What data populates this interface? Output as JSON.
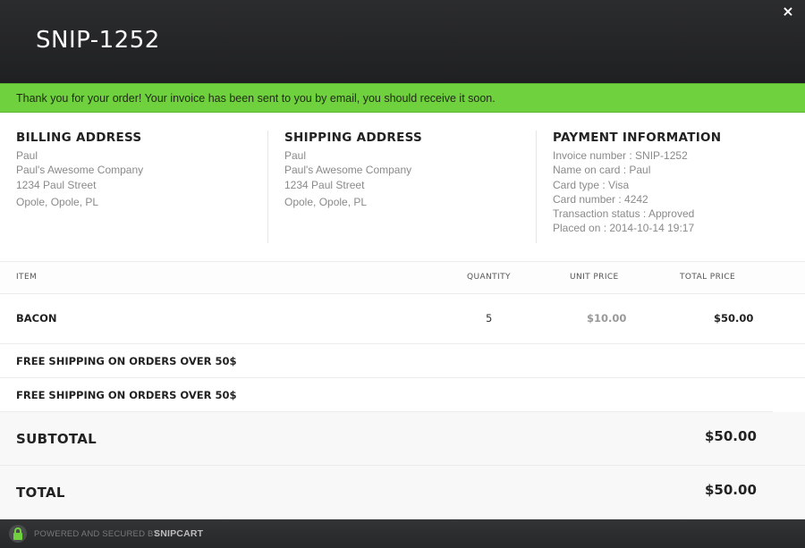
{
  "header": {
    "title": "SNIP-1252",
    "close_label": "×"
  },
  "notice": {
    "text": "Thank you for your order! Your invoice has been sent to you by email, you should receive it soon."
  },
  "billing": {
    "heading": "BILLING ADDRESS",
    "name": "Paul",
    "company": "Paul's Awesome Company",
    "street": "1234 Paul Street",
    "city": "Opole, Opole, PL"
  },
  "shipping": {
    "heading": "SHIPPING ADDRESS",
    "name": "Paul",
    "company": "Paul's Awesome Company",
    "street": "1234 Paul Street",
    "city": "Opole, Opole, PL"
  },
  "payment": {
    "heading": "PAYMENT INFORMATION",
    "invoice": "Invoice number : SNIP-1252",
    "name_on_card": "Name on card : Paul",
    "card_type": "Card type : Visa",
    "card_number": "Card number : 4242",
    "status": "Transaction status : Approved",
    "placed_on": "Placed on : 2014-10-14 19:17"
  },
  "table": {
    "headers": {
      "item": "ITEM",
      "quantity": "QUANTITY",
      "unit_price": "UNIT PRICE",
      "total_price": "TOTAL PRICE"
    },
    "items": [
      {
        "name": "BACON",
        "quantity": "5",
        "unit_price": "$10.00",
        "total_price": "$50.00"
      }
    ],
    "promos": [
      "FREE SHIPPING ON ORDERS OVER 50$",
      "FREE SHIPPING ON ORDERS OVER 50$"
    ]
  },
  "summary": {
    "subtotal_label": "SUBTOTAL",
    "subtotal_value": "$50.00",
    "total_label": "TOTAL",
    "total_value": "$50.00"
  },
  "footer": {
    "powered": "POWERED AND SECURED BY",
    "brand": "SNIPCART"
  },
  "colors": {
    "accent_green": "#6fd13d",
    "header_dark": "#232426"
  },
  "icons": {
    "close": "close-icon",
    "lock": "lock-icon"
  }
}
